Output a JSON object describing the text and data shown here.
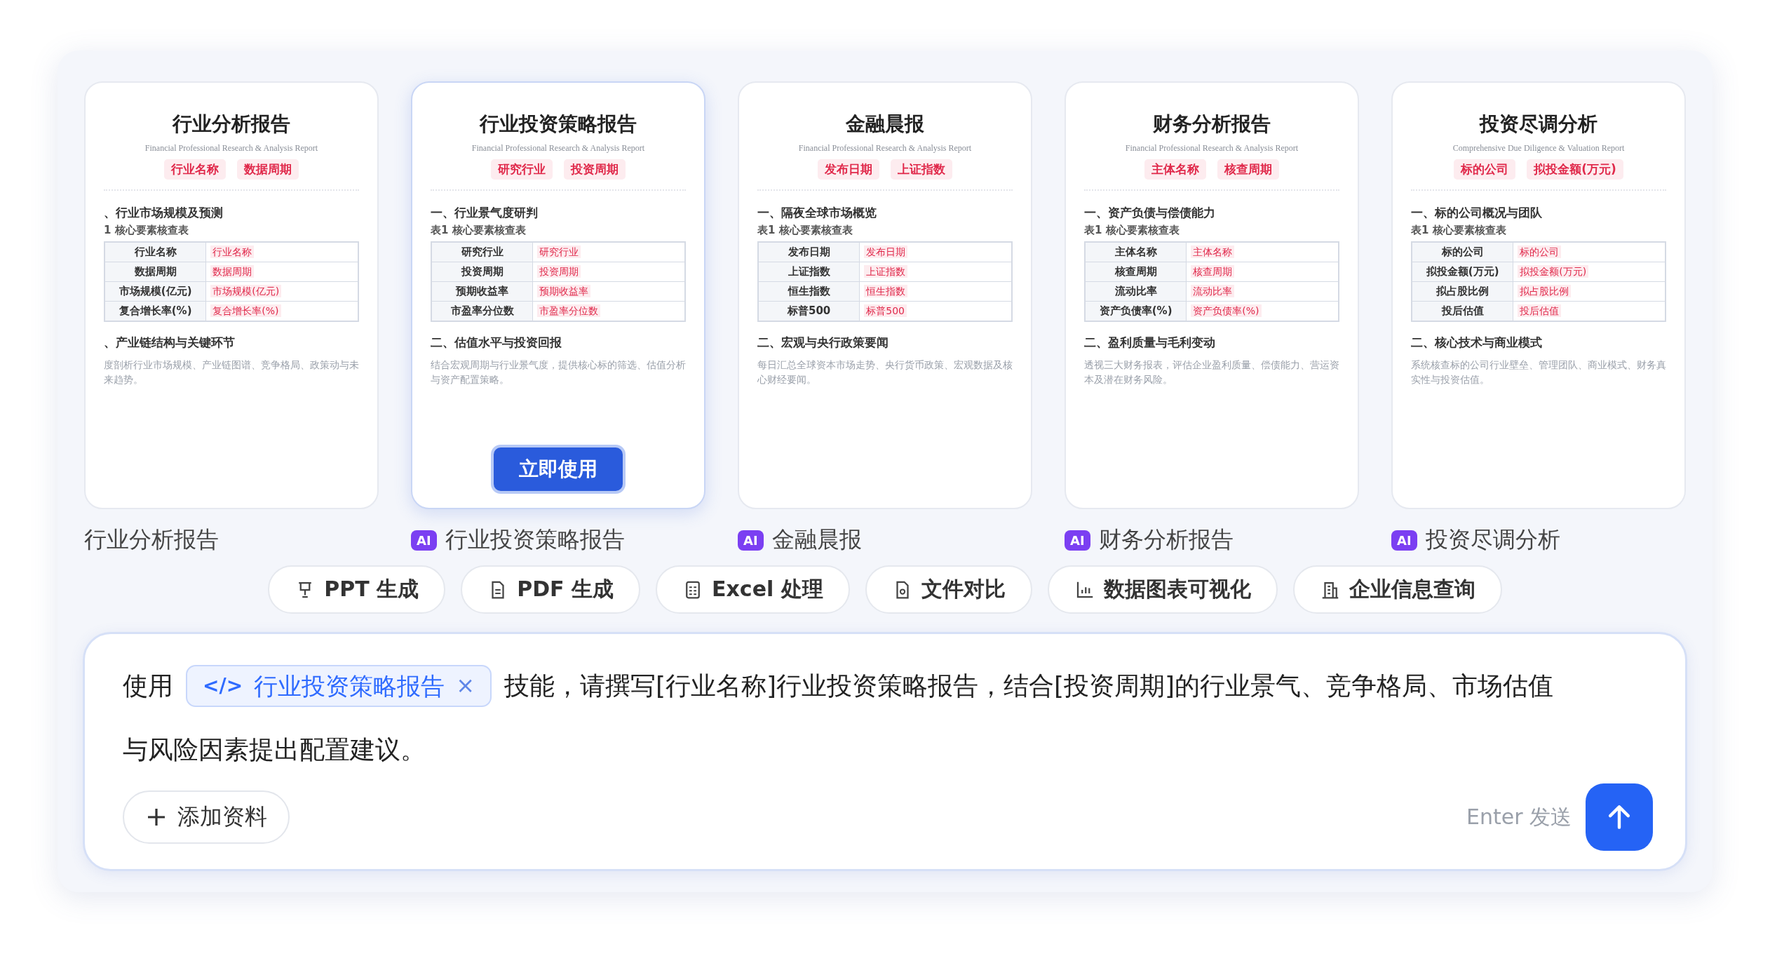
{
  "cards": [
    {
      "title": "行业分析报告",
      "subtitle": "Financial Professional Research & Analysis Report",
      "tags": [
        "行业名称",
        "数据周期"
      ],
      "section1": "、行业市场规模及预测",
      "table_caption": "1 核心要素核查表",
      "rows": [
        {
          "label": "行业名称",
          "value": "行业名称"
        },
        {
          "label": "数据周期",
          "value": "数据周期"
        },
        {
          "label": "市场规模(亿元)",
          "value": "市场规模(亿元)"
        },
        {
          "label": "复合增长率(%)",
          "value": "复合增长率(%)"
        }
      ],
      "section2": "、产业链结构与关键环节",
      "summary": "度剖析行业市场规模、产业链图谱、竞争格局、政策动与未来趋势。",
      "label": "行业分析报告",
      "selected": false
    },
    {
      "title": "行业投资策略报告",
      "subtitle": "Financial Professional Research & Analysis Report",
      "tags": [
        "研究行业",
        "投资周期"
      ],
      "section1": "一、行业景气度研判",
      "table_caption": "表1 核心要素核查表",
      "rows": [
        {
          "label": "研究行业",
          "value": "研究行业"
        },
        {
          "label": "投资周期",
          "value": "投资周期"
        },
        {
          "label": "预期收益率",
          "value": "预期收益率"
        },
        {
          "label": "市盈率分位数",
          "value": "市盈率分位数"
        }
      ],
      "section2": "二、估值水平与投资回报",
      "summary": "结合宏观周期与行业景气度，提供核心标的筛选、估值分析与资产配置策略。",
      "label": "行业投资策略报告",
      "badge": "AI",
      "selected": true
    },
    {
      "title": "金融晨报",
      "subtitle": "Financial Professional Research & Analysis Report",
      "tags": [
        "发布日期",
        "上证指数"
      ],
      "section1": "一、隔夜全球市场概览",
      "table_caption": "表1 核心要素核查表",
      "rows": [
        {
          "label": "发布日期",
          "value": "发布日期"
        },
        {
          "label": "上证指数",
          "value": "上证指数"
        },
        {
          "label": "恒生指数",
          "value": "恒生指数"
        },
        {
          "label": "标普500",
          "value": "标普500"
        }
      ],
      "section2": "二、宏观与央行政策要闻",
      "summary": "每日汇总全球资本市场走势、央行货币政策、宏观数据及核心财经要闻。",
      "label": "金融晨报",
      "badge": "AI",
      "selected": false
    },
    {
      "title": "财务分析报告",
      "subtitle": "Financial Professional Research & Analysis Report",
      "tags": [
        "主体名称",
        "核查周期"
      ],
      "section1": "一、资产负债与偿债能力",
      "table_caption": "表1 核心要素核查表",
      "rows": [
        {
          "label": "主体名称",
          "value": "主体名称"
        },
        {
          "label": "核查周期",
          "value": "核查周期"
        },
        {
          "label": "流动比率",
          "value": "流动比率"
        },
        {
          "label": "资产负债率(%)",
          "value": "资产负债率(%)"
        }
      ],
      "section2": "二、盈利质量与毛利变动",
      "summary": "透视三大财务报表，评估企业盈利质量、偿债能力、营运资本及潜在财务风险。",
      "label": "财务分析报告",
      "badge": "AI",
      "selected": false
    },
    {
      "title": "投资尽调分析",
      "subtitle": "Comprehensive Due Diligence & Valuation Report",
      "tags": [
        "标的公司",
        "拟投金额(万元)"
      ],
      "section1": "一、标的公司概况与团队",
      "table_caption": "表1 核心要素核查表",
      "rows": [
        {
          "label": "标的公司",
          "value": "标的公司"
        },
        {
          "label": "拟投金额(万元)",
          "value": "拟投金额(万元)"
        },
        {
          "label": "拟占股比例",
          "value": "拟占股比例"
        },
        {
          "label": "投后估值",
          "value": "投后估值"
        }
      ],
      "section2": "二、核心技术与商业模式",
      "summary": "系统核查标的公司行业壁垒、管理团队、商业模式、财务真实性与投资估值。",
      "label": "投资尽调分析",
      "badge": "AI",
      "selected": false
    }
  ],
  "use_button": "立即使用",
  "chips": [
    {
      "kind": "ppt",
      "label": "PPT 生成"
    },
    {
      "kind": "pdf",
      "label": "PDF 生成"
    },
    {
      "kind": "excel",
      "label": "Excel 处理"
    },
    {
      "kind": "compare",
      "label": "文件对比"
    },
    {
      "kind": "chart",
      "label": "数据图表可视化"
    },
    {
      "kind": "company",
      "label": "企业信息查询"
    }
  ],
  "composer": {
    "prefix": "使用",
    "skill_tag": {
      "icon_text": "</>",
      "label": "行业投资策略报告",
      "remove": "×"
    },
    "text_lines": [
      "技能，请撰写[行业名称]行业投资策略报告，结合[投资周期]的行业景气、竞争格局、市场估值",
      "与风险因素提出配置建议。"
    ],
    "add_button": "添加资料",
    "hint": "Enter 发送"
  }
}
